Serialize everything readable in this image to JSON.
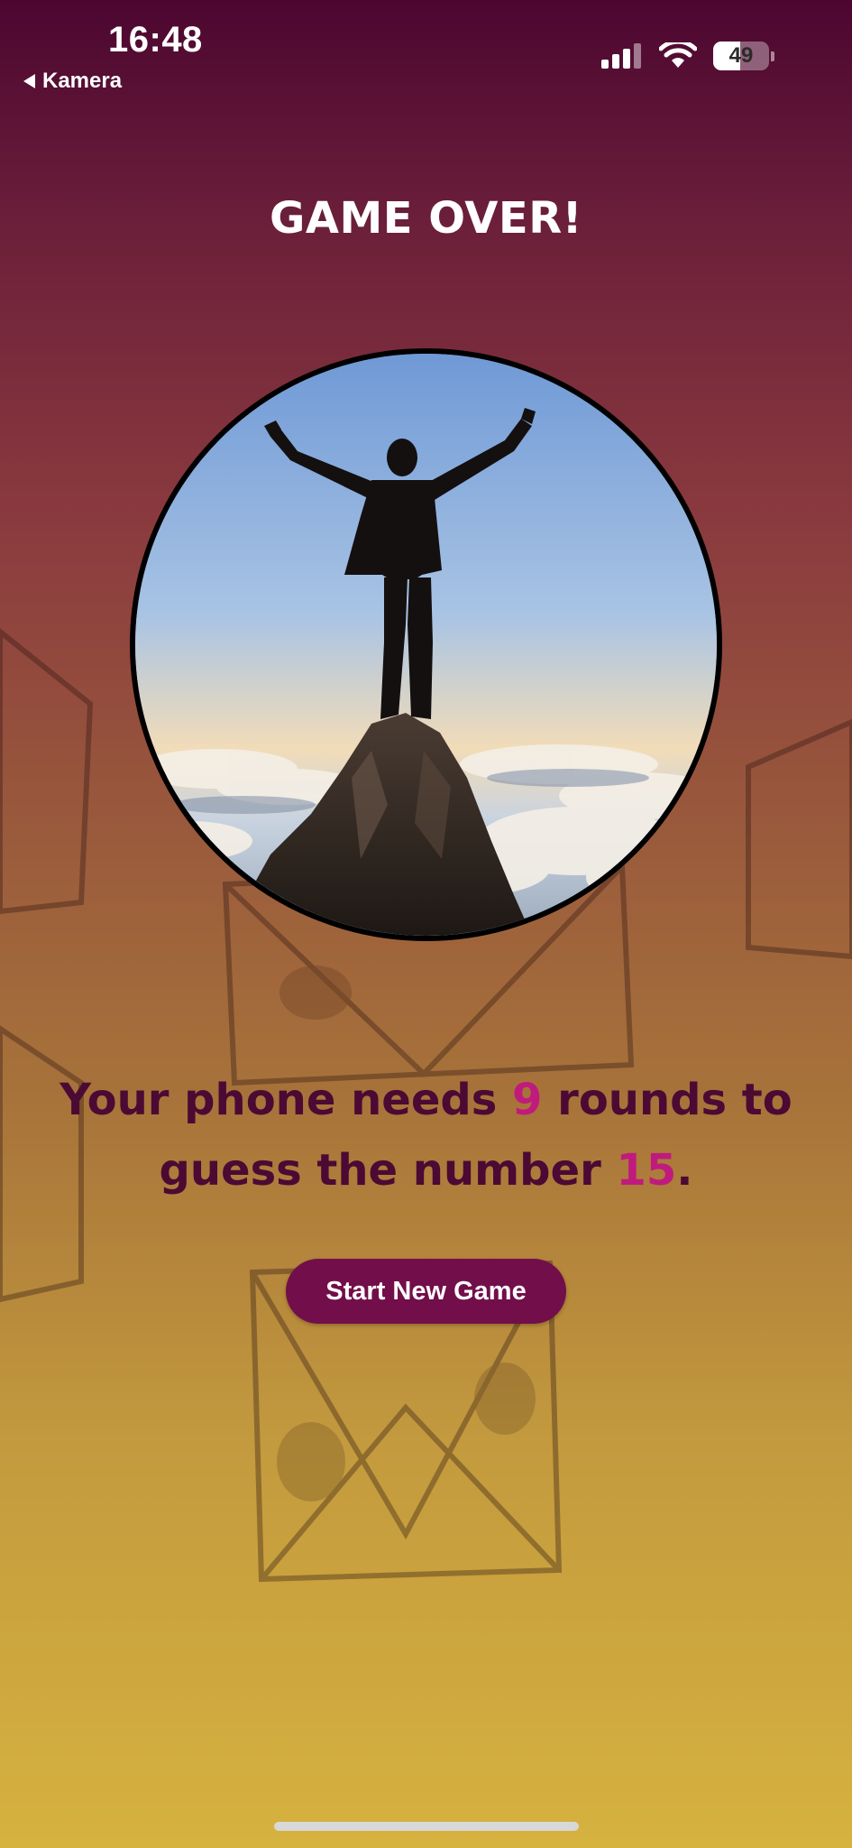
{
  "status_bar": {
    "time": "16:48",
    "back_label": "Kamera",
    "battery_level": "49",
    "battery_fraction": 0.49
  },
  "game_over": {
    "title": "GAME OVER!",
    "summary_prefix": "Your phone needs ",
    "rounds": "9",
    "summary_middle": " rounds to guess the number ",
    "target_number": "15",
    "summary_suffix": "."
  },
  "actions": {
    "start_new_game_label": "Start New Game"
  },
  "colors": {
    "accent": "#720e4a",
    "highlight": "#c01a7e",
    "text_dark": "#4a0a33",
    "gradient_top": "#4c0630",
    "gradient_bottom": "#d6b23f"
  },
  "icons": {
    "back": "back-arrow-icon",
    "signal": "cellular-signal-icon",
    "wifi": "wifi-icon",
    "battery": "battery-icon"
  }
}
